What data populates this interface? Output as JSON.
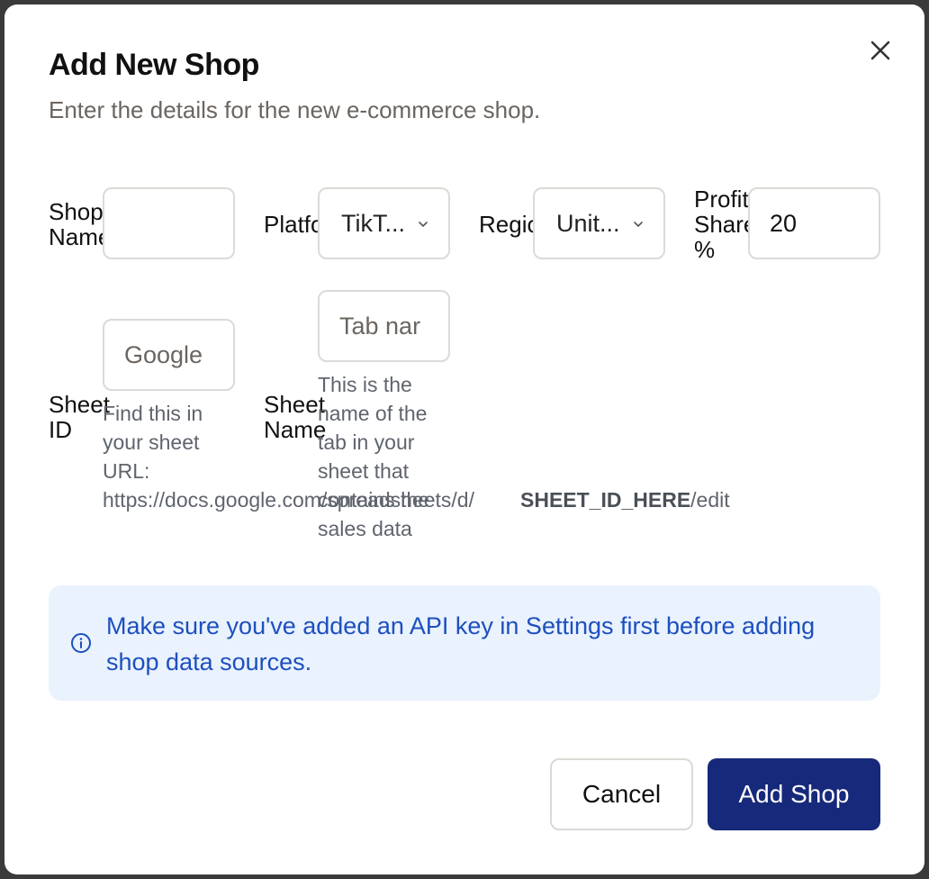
{
  "dialog": {
    "title": "Add New Shop",
    "subtitle": "Enter the details for the new e-commerce shop.",
    "close_icon": "close-icon"
  },
  "form": {
    "shop_name": {
      "label": "Shop Name",
      "value": "",
      "placeholder": ""
    },
    "platform": {
      "label": "Platform",
      "value": "TikT..."
    },
    "region": {
      "label": "Region",
      "value": "Unit..."
    },
    "profit_share": {
      "label": "Profit Share %",
      "value": "20"
    },
    "sheet_id": {
      "label": "Sheet ID",
      "placeholder": "Google",
      "help_prefix": "Find this in your sheet URL: https://docs.google.com/spreadsheets/d/",
      "help_highlight": "SHEET_ID_HERE",
      "help_suffix": "/edit"
    },
    "sheet_name": {
      "label": "Sheet Name",
      "placeholder": "Tab nar",
      "help": "This is the name of the tab in your sheet that contains the sales data"
    }
  },
  "info": {
    "icon": "info-icon",
    "message": "Make sure you've added an API key in Settings first before adding shop data sources.",
    "color": "#1d4fbf",
    "background": "#e9f2fd"
  },
  "actions": {
    "cancel_label": "Cancel",
    "submit_label": "Add Shop",
    "submit_color": "#17297a"
  }
}
